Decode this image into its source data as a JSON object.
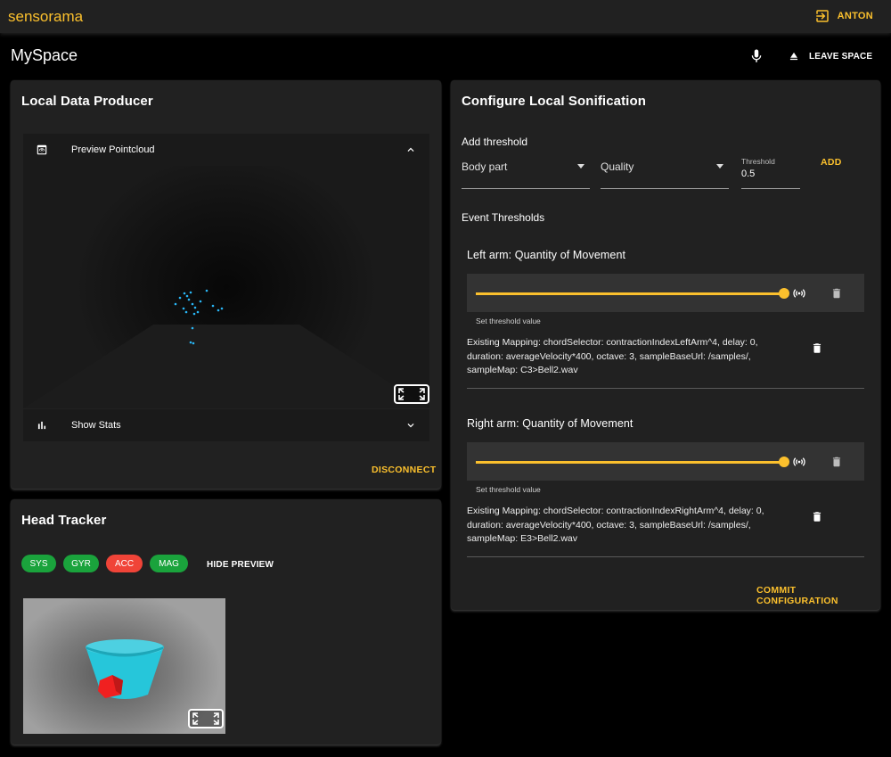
{
  "app": {
    "brand": "sensorama",
    "user": "ANTON"
  },
  "space": {
    "title": "MySpace",
    "leave_label": "LEAVE SPACE"
  },
  "producer": {
    "title": "Local Data Producer",
    "preview_label": "Preview Pointcloud",
    "stats_label": "Show Stats",
    "disconnect_label": "DISCONNECT"
  },
  "head_tracker": {
    "title": "Head Tracker",
    "chips": [
      {
        "label": "SYS",
        "status": "ok"
      },
      {
        "label": "GYR",
        "status": "ok"
      },
      {
        "label": "ACC",
        "status": "error"
      },
      {
        "label": "MAG",
        "status": "ok"
      }
    ],
    "hide_preview_label": "HIDE PREVIEW"
  },
  "sonification": {
    "title": "Configure Local Sonification",
    "add_threshold_label": "Add threshold",
    "body_part_placeholder": "Body part",
    "quality_placeholder": "Quality",
    "threshold_label": "Threshold",
    "threshold_value": "0.5",
    "add_label": "ADD",
    "event_thresholds_label": "Event Thresholds",
    "thresholds": [
      {
        "title": "Left arm: Quantity of Movement",
        "hint": "Set threshold value",
        "value": 1.0,
        "mapping": "Existing Mapping: chordSelector: contractionIndexLeftArm^4, delay: 0, duration: averageVelocity*400, octave: 3, sampleBaseUrl: /samples/, sampleMap: C3>Bell2.wav"
      },
      {
        "title": "Right arm: Quantity of Movement",
        "hint": "Set threshold value",
        "value": 1.0,
        "mapping": "Existing Mapping: chordSelector: contractionIndexRightArm^4, delay: 0, duration: averageVelocity*400, octave: 3, sampleBaseUrl: /samples/, sampleMap: E3>Bell2.wav"
      }
    ],
    "commit_label": "COMMIT CONFIGURATION"
  },
  "colors": {
    "accent": "#fbc02d",
    "chip_ok": "#1aa33c",
    "chip_error": "#f04438",
    "surface": "#212121"
  },
  "icons": {
    "logout": "logout-icon",
    "mic": "microphone-icon",
    "eject": "eject-icon",
    "preview": "preview-icon",
    "chevron_up": "chevron-up-icon",
    "stats": "bar-chart-icon",
    "chevron_down": "chevron-down-icon",
    "fullscreen": "fullscreen-icon",
    "sound": "sound-waves-icon",
    "delete": "trash-icon"
  }
}
